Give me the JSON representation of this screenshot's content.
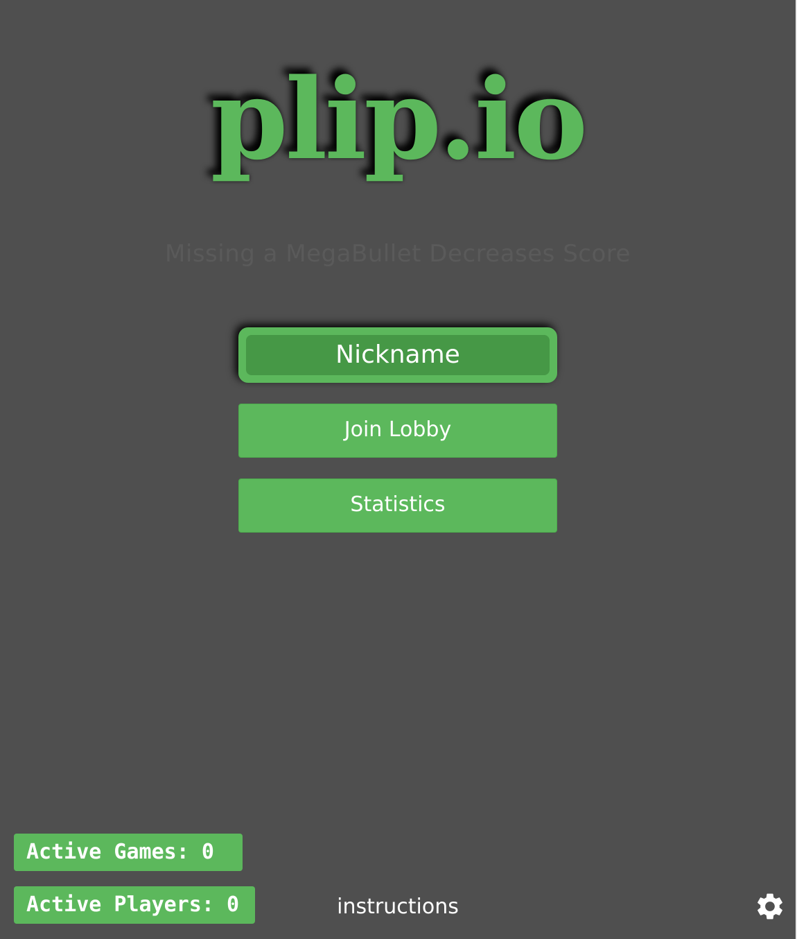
{
  "logo": {
    "text": "plip.io",
    "color": "#5cb85c"
  },
  "tip": {
    "text": "Missing a MegaBullet Decreases Score"
  },
  "nickname_input": {
    "placeholder": "Nickname"
  },
  "buttons": {
    "join_lobby": "Join Lobby",
    "statistics": "Statistics"
  },
  "stats": {
    "active_games_label": "Active Games: 0",
    "active_players_label": "Active Players: 0",
    "active_games": 0,
    "active_players": 0
  },
  "footer": {
    "instructions_link": "instructions",
    "settings_icon": "gear-icon"
  },
  "colors": {
    "accent": "#5cb85c",
    "accent_dark": "#469846",
    "background": "#4f4f4f"
  }
}
